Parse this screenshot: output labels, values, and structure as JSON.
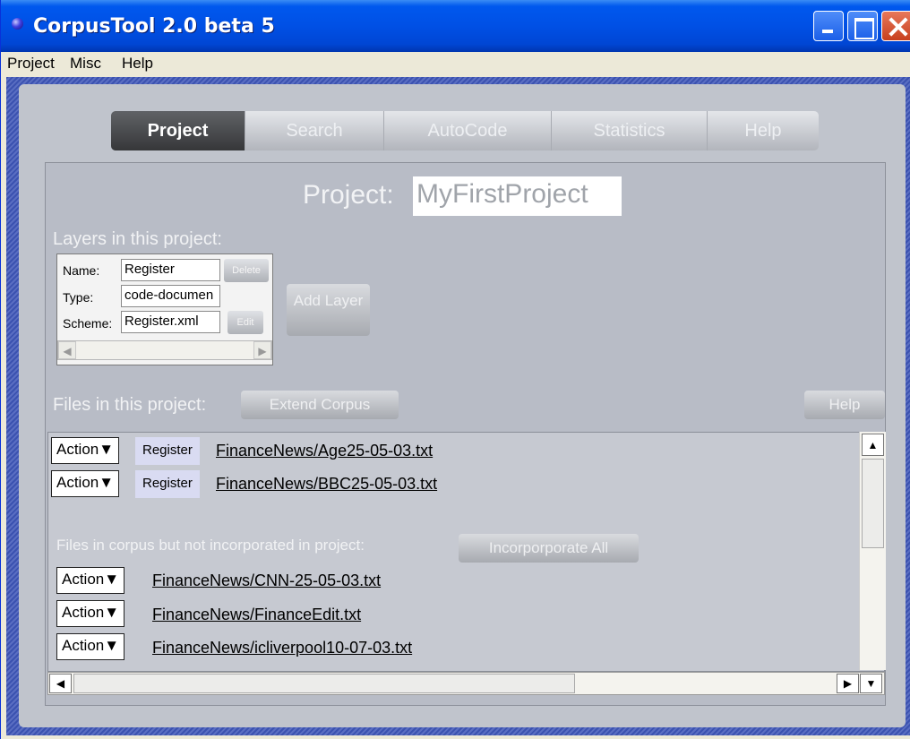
{
  "window": {
    "title": "CorpusTool 2.0 beta 5"
  },
  "menu": {
    "items": [
      "Project",
      "Misc",
      "Help"
    ]
  },
  "tabs": [
    "Project",
    "Search",
    "AutoCode",
    "Statistics",
    "Help"
  ],
  "project": {
    "label": "Project:",
    "name": "MyFirstProject"
  },
  "layers": {
    "heading": "Layers in this project:",
    "name_label": "Name:",
    "name_value": "Register",
    "type_label": "Type:",
    "type_value": "code-documen",
    "scheme_label": "Scheme:",
    "scheme_value": "Register.xml",
    "delete_label": "Delete",
    "edit_label": "Edit",
    "add_layer_label": "Add Layer"
  },
  "files": {
    "heading": "Files in this project:",
    "extend_label": "Extend Corpus",
    "help_label": "Help",
    "action_label": "Action▼",
    "project_files": [
      {
        "layer": "Register",
        "path": "FinanceNews/Age25-05-03.txt"
      },
      {
        "layer": "Register",
        "path": "FinanceNews/BBC25-05-03.txt"
      }
    ],
    "unincorporated_heading": "Files in corpus but not incorporated in project:",
    "incorporate_all_label": "Incorporporate All",
    "unincorporated_files": [
      "FinanceNews/CNN-25-05-03.txt",
      "FinanceNews/FinanceEdit.txt",
      "FinanceNews/icliverpool10-07-03.txt"
    ]
  }
}
